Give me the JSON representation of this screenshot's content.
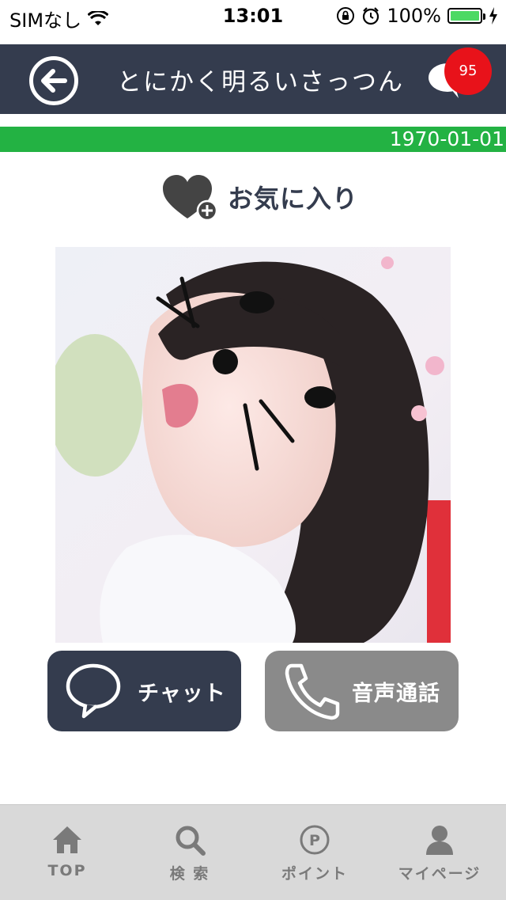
{
  "status_bar": {
    "carrier": "SIMなし",
    "time": "13:01",
    "battery": "100%",
    "icons": [
      "wifi-icon",
      "orientation-lock-icon",
      "alarm-icon",
      "battery-icon",
      "charging-icon"
    ]
  },
  "header": {
    "title": "とにかく明るいさっつん",
    "badge_count": "95",
    "colors": {
      "background": "#343c4e",
      "badge": "#e8121a"
    }
  },
  "date_bar": {
    "date": "1970-01-01",
    "color": "#23b243"
  },
  "favorite": {
    "label": "お気に入り",
    "icon": "heart-plus-icon"
  },
  "profile_photo": {
    "icon": "profile-photo"
  },
  "actions": {
    "chat_label": "チャット",
    "call_label": "音声通話",
    "chat_icon": "chat-bubble-icon",
    "call_icon": "phone-icon"
  },
  "tabbar": {
    "items": [
      {
        "label": "TOP",
        "icon": "home-icon"
      },
      {
        "label": "検 索",
        "icon": "search-icon"
      },
      {
        "label": "ポイント",
        "icon": "point-icon"
      },
      {
        "label": "マイページ",
        "icon": "user-icon"
      }
    ]
  }
}
